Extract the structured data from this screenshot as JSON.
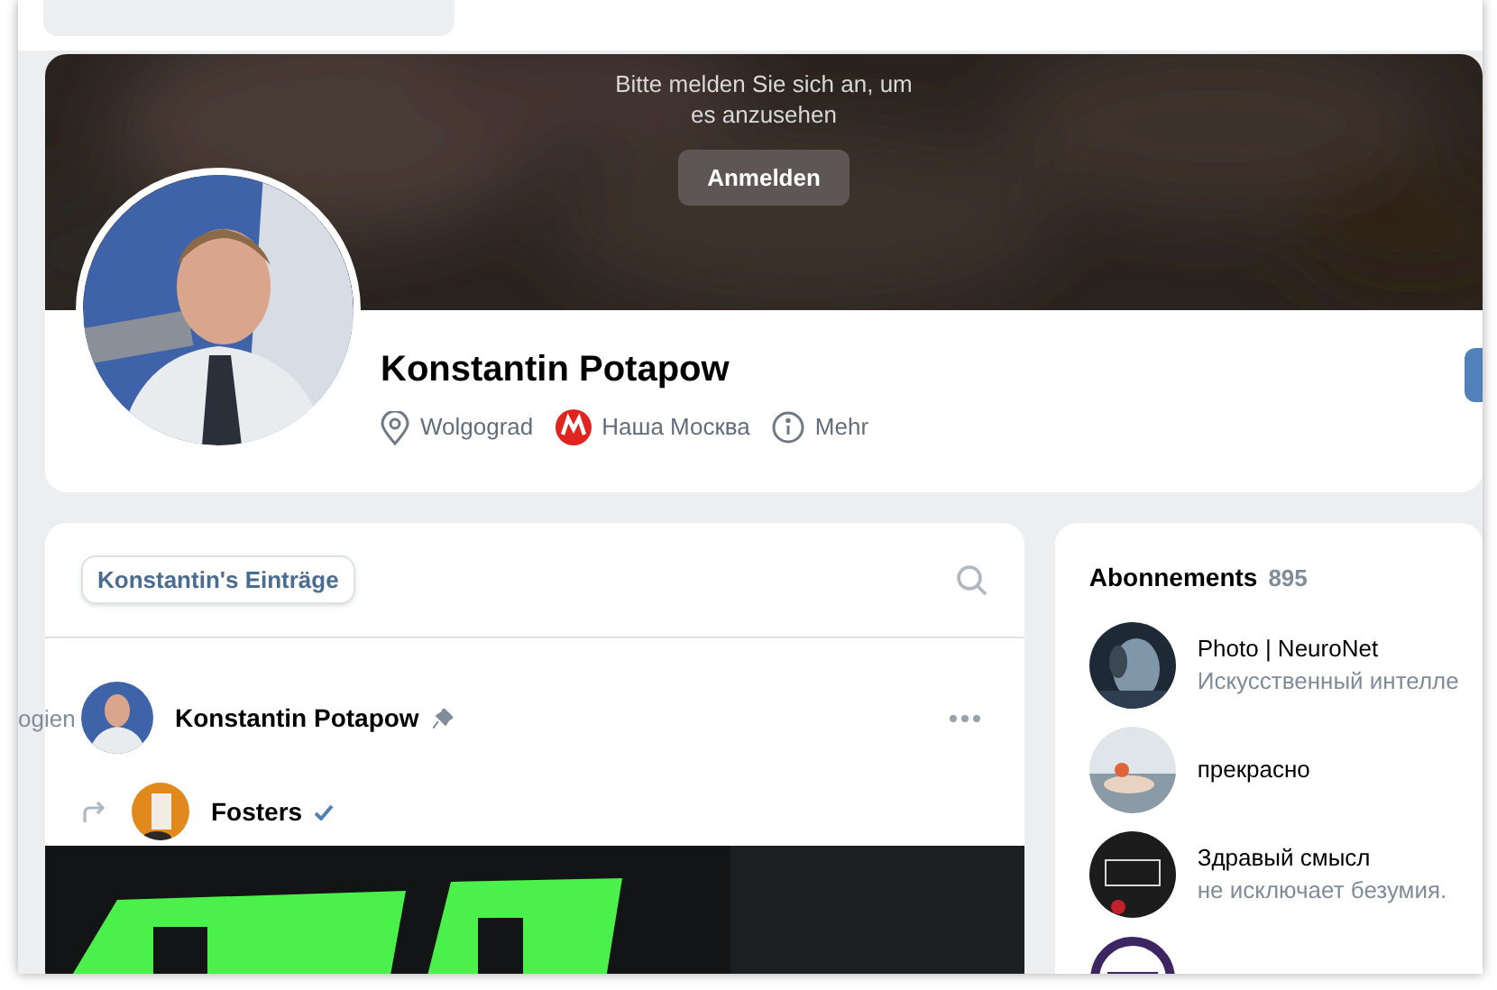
{
  "sidebar": {
    "items": [
      {
        "label": "ogien"
      }
    ]
  },
  "profile": {
    "cover": {
      "message": "Bitte melden Sie sich an, um es anzusehen",
      "button": "Anmelden"
    },
    "name": "Konstantin Potapow",
    "details": [
      {
        "kind": "location",
        "label": "Wolgograd"
      },
      {
        "kind": "metro",
        "label": "Наша Москва"
      },
      {
        "kind": "info",
        "label": "Mehr"
      }
    ]
  },
  "wall": {
    "tabs": [
      {
        "label": "Konstantin's Einträge",
        "selected": true
      }
    ],
    "post": {
      "author": "Konstantin Potapow",
      "pinned": true,
      "repost": {
        "source": "Fosters",
        "verified": true
      }
    }
  },
  "subscriptions": {
    "title": "Abonnements",
    "count": "895",
    "items": [
      {
        "name": "Photo | NeuroNet",
        "description": "Искусственный интелле"
      },
      {
        "name": "прекрасно"
      },
      {
        "name": "Здравый смысл",
        "description": "не исключает безумия."
      }
    ]
  }
}
